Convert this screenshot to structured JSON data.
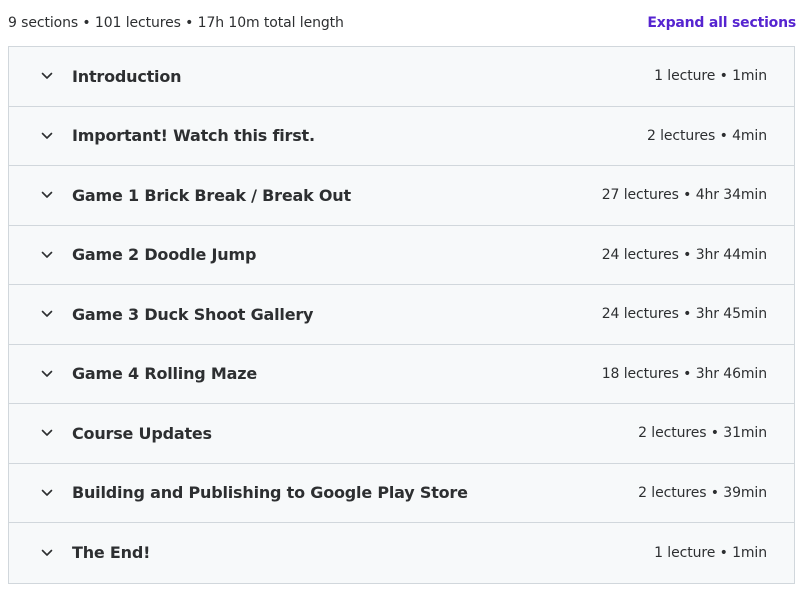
{
  "header": {
    "summary": "9 sections • 101 lectures • 17h 10m total length",
    "expand_all_label": "Expand all sections"
  },
  "sections": [
    {
      "title": "Introduction",
      "meta": "1 lecture • 1min"
    },
    {
      "title": "Important! Watch this first.",
      "meta": "2 lectures • 4min"
    },
    {
      "title": "Game 1 Brick Break / Break Out",
      "meta": "27 lectures • 4hr 34min"
    },
    {
      "title": "Game 2 Doodle Jump",
      "meta": "24 lectures • 3hr 44min"
    },
    {
      "title": "Game 3 Duck Shoot Gallery",
      "meta": "24 lectures • 3hr 45min"
    },
    {
      "title": "Game 4 Rolling Maze",
      "meta": "18 lectures • 3hr 46min"
    },
    {
      "title": "Course Updates",
      "meta": "2 lectures • 31min"
    },
    {
      "title": "Building and Publishing to Google Play Store",
      "meta": "2 lectures • 39min"
    },
    {
      "title": "The End!",
      "meta": "1 lecture • 1min"
    }
  ],
  "icons": {
    "section_toggle": "chevron-down-icon"
  },
  "colors": {
    "accent": "#5624d0",
    "section_bg": "#f7f9fa",
    "border": "#d1d7dc",
    "text": "#2d2f31"
  }
}
